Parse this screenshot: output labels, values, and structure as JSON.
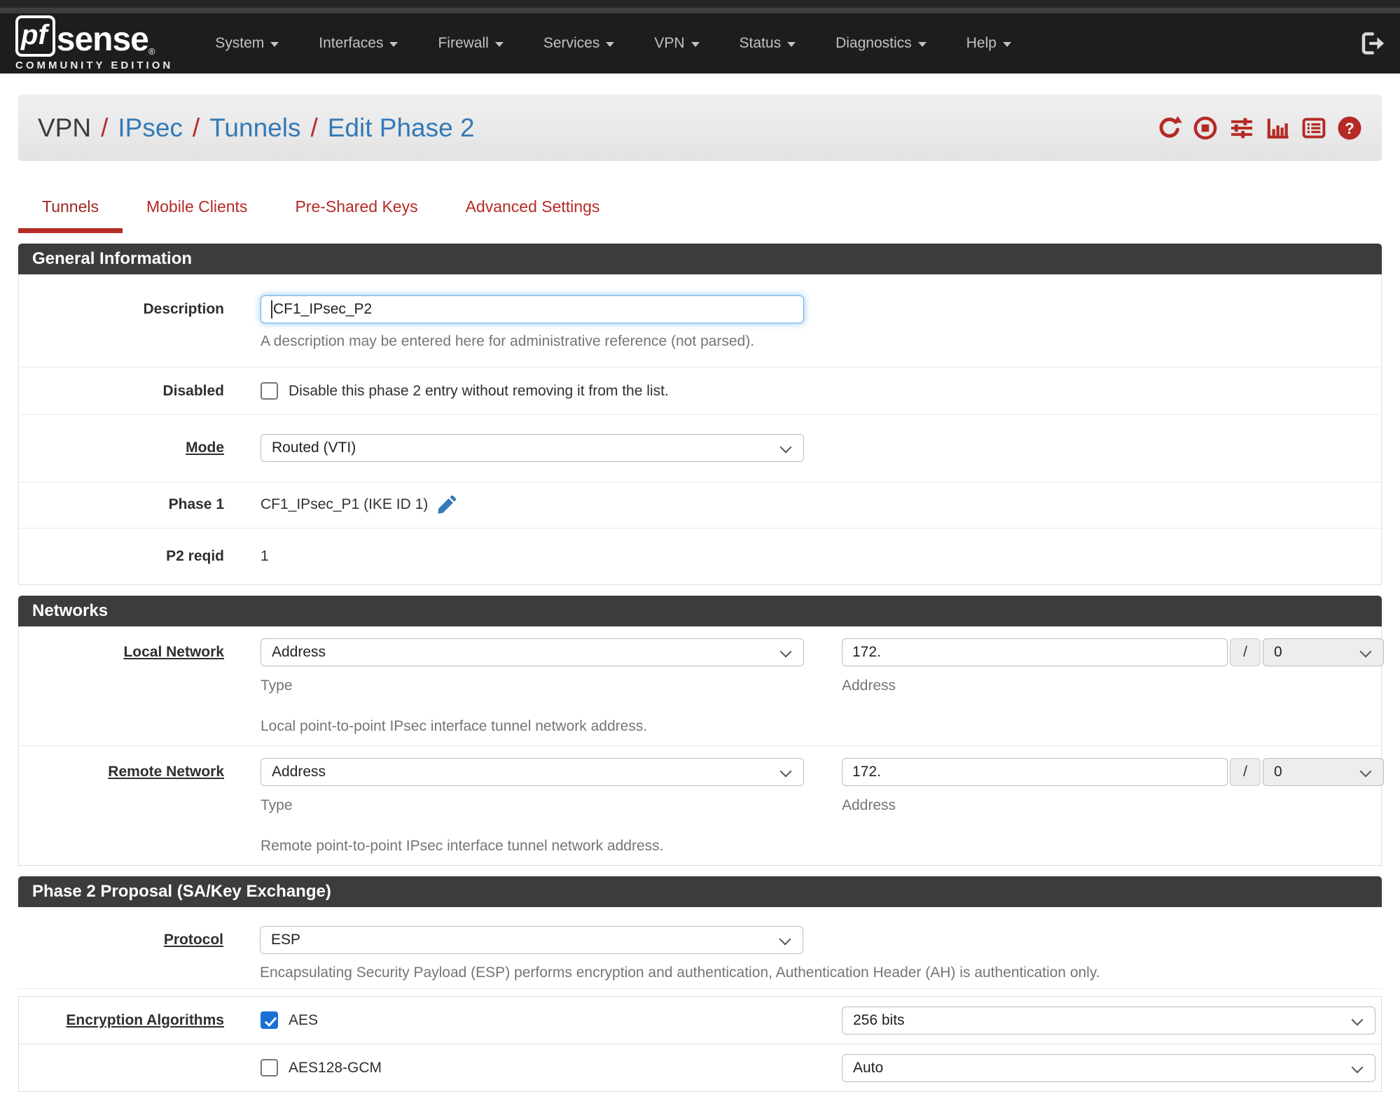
{
  "navbar": {
    "logo": {
      "pf": "pf",
      "sense": "sense",
      "reg": "®",
      "edition": "COMMUNITY EDITION"
    },
    "items": [
      {
        "label": "System"
      },
      {
        "label": "Interfaces"
      },
      {
        "label": "Firewall"
      },
      {
        "label": "Services"
      },
      {
        "label": "VPN"
      },
      {
        "label": "Status"
      },
      {
        "label": "Diagnostics"
      },
      {
        "label": "Help"
      }
    ],
    "logout_icon": "sign-out"
  },
  "breadcrumb": {
    "root": "VPN",
    "separator": "/",
    "links": [
      "IPsec",
      "Tunnels",
      "Edit Phase 2"
    ],
    "action_icons": [
      "refresh",
      "stop-circle",
      "sliders",
      "bar-chart",
      "list-alt",
      "help"
    ]
  },
  "tabs": [
    {
      "label": "Tunnels",
      "active": true
    },
    {
      "label": "Mobile Clients",
      "active": false
    },
    {
      "label": "Pre-Shared Keys",
      "active": false
    },
    {
      "label": "Advanced Settings",
      "active": false
    }
  ],
  "general": {
    "title": "General Information",
    "description_label": "Description",
    "description_value": "CF1_IPsec_P2",
    "description_help": "A description may be entered here for administrative reference (not parsed).",
    "disabled_label": "Disabled",
    "disabled_text": "Disable this phase 2 entry without removing it from the list.",
    "disabled_checked": false,
    "mode_label": "Mode",
    "mode_value": "Routed (VTI)",
    "phase1_label": "Phase 1",
    "phase1_value": "CF1_IPsec_P1 (IKE ID 1)",
    "phase1_edit_icon": "pencil",
    "p2reqid_label": "P2 reqid",
    "p2reqid_value": "1"
  },
  "networks": {
    "title": "Networks",
    "local": {
      "label": "Local Network",
      "type_value": "Address",
      "type_help": "Type",
      "address_value": "172.",
      "slash": "/",
      "mask_value": "0",
      "address_help": "Address",
      "row_help": "Local point-to-point IPsec interface tunnel network address."
    },
    "remote": {
      "label": "Remote Network",
      "type_value": "Address",
      "type_help": "Type",
      "address_value": "172.",
      "slash": "/",
      "mask_value": "0",
      "address_help": "Address",
      "row_help": "Remote point-to-point IPsec interface tunnel network address."
    }
  },
  "proposal": {
    "title": "Phase 2 Proposal (SA/Key Exchange)",
    "protocol_label": "Protocol",
    "protocol_value": "ESP",
    "protocol_help": "Encapsulating Security Payload (ESP) performs encryption and authentication, Authentication Header (AH) is authentication only.",
    "encryption_label": "Encryption Algorithms",
    "algorithms": [
      {
        "name": "AES",
        "checked": true,
        "bits": "256 bits"
      },
      {
        "name": "AES128-GCM",
        "checked": false,
        "bits": "Auto"
      }
    ]
  },
  "colors": {
    "accent_red": "#b52a25",
    "link_blue": "#337ab7",
    "navbar_dark": "#1d1d1d",
    "panel_header": "#3c3c3c",
    "focus_blue": "#66afe9",
    "checkbox_blue": "#1a6fd6"
  }
}
